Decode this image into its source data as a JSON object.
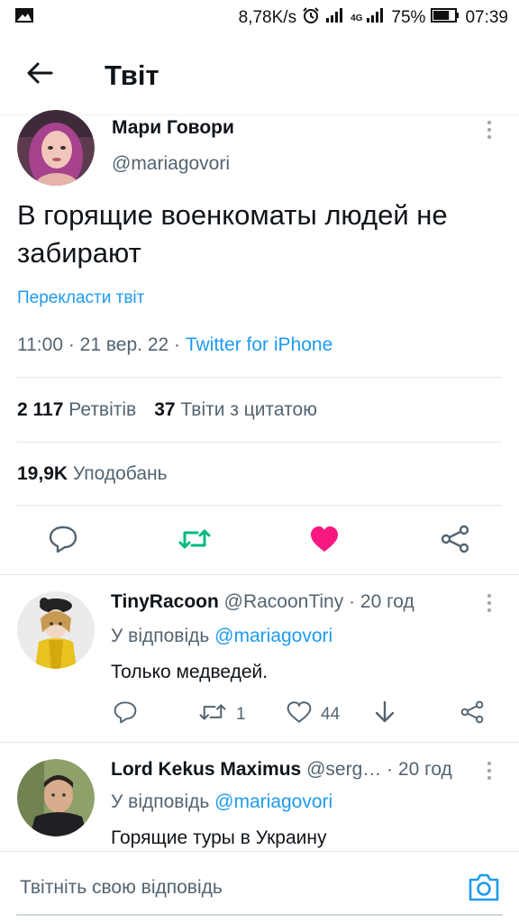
{
  "status_bar": {
    "net_speed": "8,78K/s",
    "network_type": "4G",
    "battery_percent": "75%",
    "battery_level": 0.75,
    "time": "07:39",
    "icons": [
      "image-icon",
      "alarm-icon",
      "signal-icon",
      "signal-4g-icon",
      "battery-icon"
    ]
  },
  "header": {
    "title": "Твіт",
    "back_icon": "arrow-left-icon"
  },
  "main_tweet": {
    "author_name": "Мари Говори",
    "author_handle": "@mariagovori",
    "text": "В горящие военкоматы людей не забирают",
    "translate_label": "Перекласти твіт",
    "time": "11:00",
    "date": "21 вер. 22",
    "source": "Twitter for iPhone",
    "retweets_count": "2 117",
    "retweets_label": "Ретвітів",
    "quotes_count": "37",
    "quotes_label": "Твіти з цитатою",
    "likes_count": "19,9K",
    "likes_label": "Уподобань",
    "liked": true,
    "colors": {
      "link": "#1d9bf0",
      "retweet": "#00ba7c",
      "like": "#f91880"
    }
  },
  "replies": [
    {
      "author_name": "TinyRacoon",
      "author_handle": "@RacoonTiny",
      "age": "20 год",
      "reply_to_prefix": "У відповідь",
      "reply_to_handle": "@mariagovori",
      "text": "Только медведей.",
      "retweets": "1",
      "likes": "44"
    },
    {
      "author_name": "Lord Kekus Maximus",
      "author_handle": "@serg…",
      "age": "20 год",
      "reply_to_prefix": "У відповідь",
      "reply_to_handle": "@mariagovori",
      "text": "Горящие туры в Украину"
    }
  ],
  "compose": {
    "placeholder": "Твітніть свою відповідь"
  }
}
